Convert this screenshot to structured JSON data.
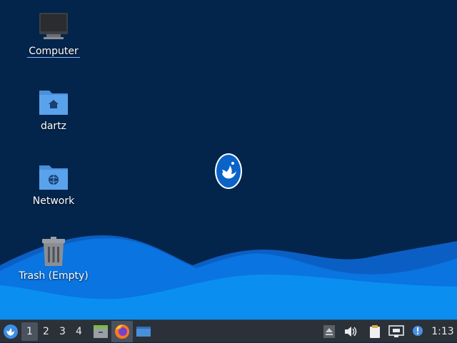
{
  "desktop": {
    "icons": [
      {
        "label": "Computer",
        "icon": "computer-icon"
      },
      {
        "label": "dartz",
        "icon": "home-folder-icon"
      },
      {
        "label": "Network",
        "icon": "network-folder-icon"
      },
      {
        "label": "Trash (Empty)",
        "icon": "trash-icon"
      }
    ],
    "colors": {
      "background": "#03254c",
      "wave_light": "#0a8ff0",
      "wave_mid": "#0a74e0",
      "wave_dark": "#0b5fc4"
    }
  },
  "taskbar": {
    "workspaces": [
      "1",
      "2",
      "3",
      "4"
    ],
    "active_workspace": "1",
    "launchers": [
      "file-manager-icon",
      "firefox-icon",
      "window-icon"
    ],
    "tray": [
      "eject-icon",
      "volume-icon",
      "clipboard-icon",
      "network-status-icon",
      "notification-icon"
    ],
    "clock": "1:13"
  }
}
